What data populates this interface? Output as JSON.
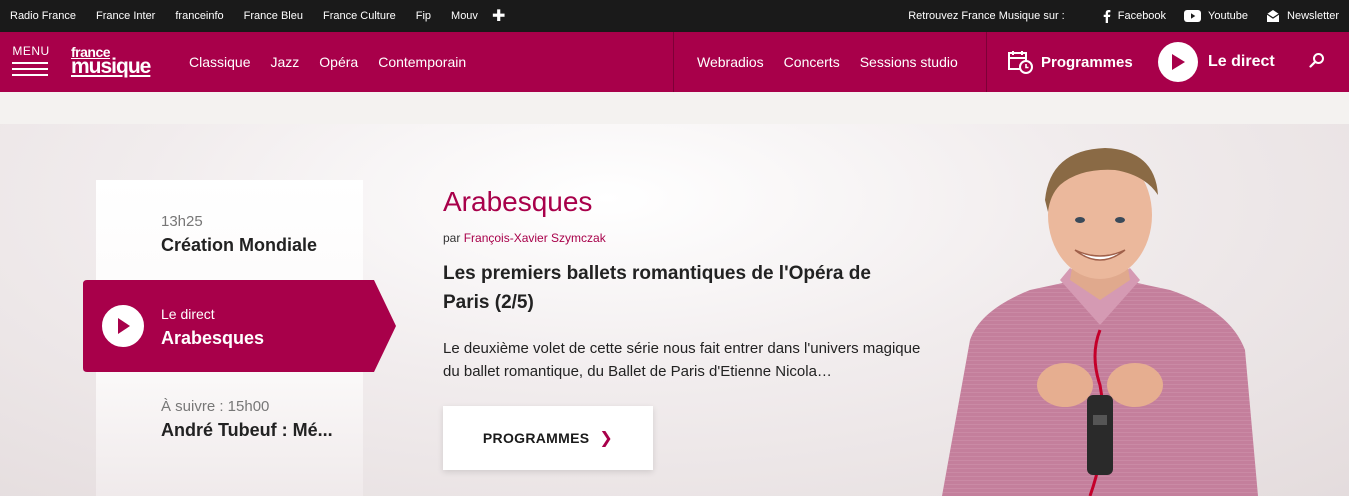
{
  "network": {
    "links": [
      "Radio France",
      "France Inter",
      "franceinfo",
      "France Bleu",
      "France Culture",
      "Fip",
      "Mouv"
    ],
    "more_icon": "plus-icon",
    "social_label": "Retrouvez France Musique sur :",
    "social": [
      {
        "label": "Facebook",
        "icon": "facebook-icon"
      },
      {
        "label": "Youtube",
        "icon": "youtube-icon"
      },
      {
        "label": "Newsletter",
        "icon": "newsletter-icon"
      }
    ]
  },
  "nav": {
    "menu_label": "MENU",
    "logo_top": "france",
    "logo_bottom": "musique",
    "genres": [
      "Classique",
      "Jazz",
      "Opéra",
      "Contemporain"
    ],
    "secondary": [
      "Webradios",
      "Concerts",
      "Sessions studio"
    ],
    "programmes_label": "Programmes",
    "direct_label": "Le direct",
    "accent": "#a8004a"
  },
  "timeline": {
    "previous": {
      "time": "13h25",
      "title": "Création Mondiale"
    },
    "current": {
      "label": "Le direct",
      "title": "Arabesques"
    },
    "next": {
      "time": "À suivre : 15h00",
      "title": "André Tubeuf : Mé..."
    }
  },
  "show": {
    "name": "Arabesques",
    "by_prefix": "par",
    "host": "François-Xavier Szymczak",
    "episode": "Les premiers ballets romantiques de l'Opéra de Paris (2/5)",
    "description": "Le deuxième volet de cette série nous fait entrer dans l'univers magique du ballet romantique, du Ballet de Paris d'Etienne Nicola…",
    "cta": "PROGRAMMES"
  }
}
